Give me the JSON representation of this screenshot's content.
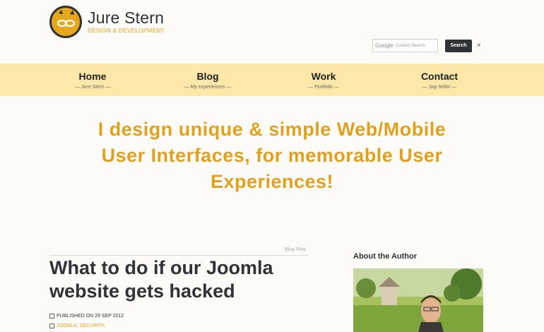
{
  "brand": {
    "name": "Jure Stern",
    "tagline": "DESIGN & DEVELOPMENT",
    "accent": "#e0a21e",
    "dark": "#2f3236"
  },
  "search": {
    "google_label": "Google",
    "placeholder": "Custom Search",
    "button": "Search",
    "close": "×"
  },
  "nav": {
    "items": [
      {
        "label": "Home",
        "sub": "— Jure Stern —"
      },
      {
        "label": "Blog",
        "sub": "— My experiences —"
      },
      {
        "label": "Work",
        "sub": "— Portfolio —"
      },
      {
        "label": "Contact",
        "sub": "— Say hello! —"
      }
    ],
    "background": "#fde8a9"
  },
  "hero": {
    "line1": "I design unique & simple Web/Mobile",
    "line2": "User Interfaces, for memorable User",
    "line3": "Experiences!"
  },
  "post": {
    "section_label": "Blog Post",
    "title_line1": "What to do if our Joomla",
    "title_line2": "website gets hacked",
    "published": "PUBLISHED ON 29 SEP 2012",
    "tags": "JOOMLA, SECURITY,"
  },
  "sidebar": {
    "about_title": "About the Author"
  }
}
